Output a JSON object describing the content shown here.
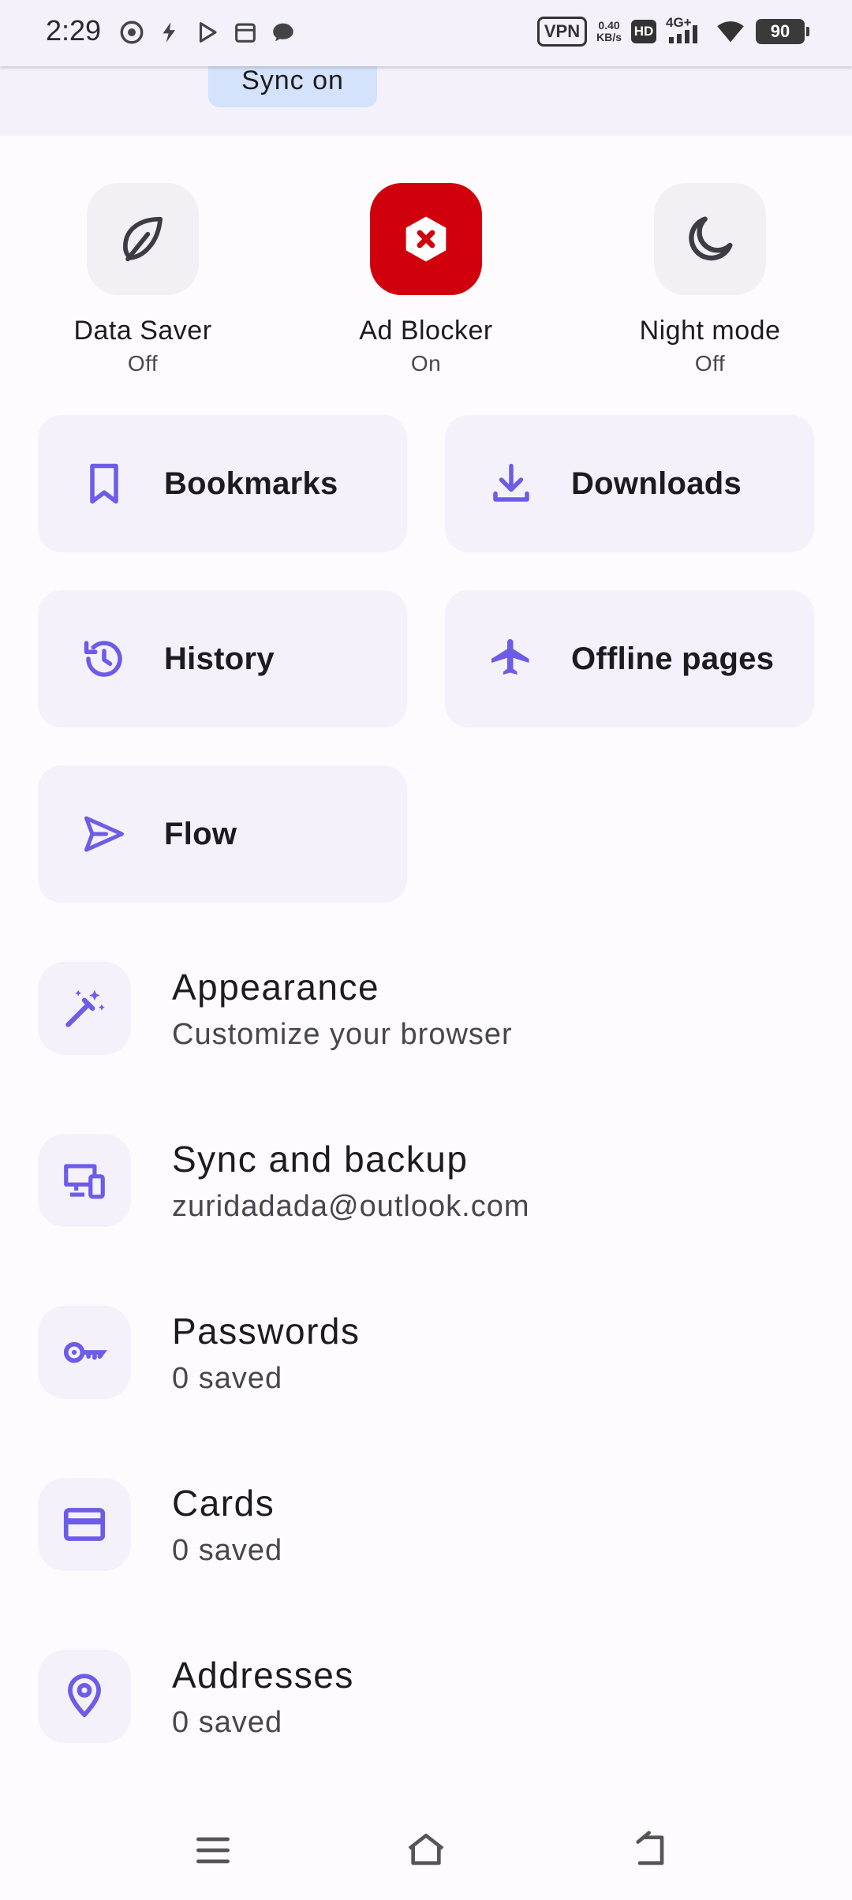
{
  "status_bar": {
    "time": "2:29",
    "vpn": "VPN",
    "net_speed_value": "0.40",
    "net_speed_unit": "KB/s",
    "hd": "HD",
    "signal": "4G+",
    "battery": "90"
  },
  "header": {
    "sync_label": "Sync on"
  },
  "quick_toggles": [
    {
      "label": "Data Saver",
      "state": "Off",
      "icon": "leaf-icon"
    },
    {
      "label": "Ad Blocker",
      "state": "On",
      "icon": "ad-blocker-icon"
    },
    {
      "label": "Night mode",
      "state": "Off",
      "icon": "moon-icon"
    }
  ],
  "tiles": [
    {
      "label": "Bookmarks",
      "icon": "bookmark-icon"
    },
    {
      "label": "Downloads",
      "icon": "download-icon"
    },
    {
      "label": "History",
      "icon": "history-icon"
    },
    {
      "label": "Offline pages",
      "icon": "airplane-icon"
    },
    {
      "label": "Flow",
      "icon": "send-icon"
    }
  ],
  "list": [
    {
      "title": "Appearance",
      "subtitle": "Customize your browser",
      "icon": "magic-wand-icon"
    },
    {
      "title": "Sync and backup",
      "subtitle": "zuridadada@outlook.com",
      "icon": "devices-icon"
    },
    {
      "title": "Passwords",
      "subtitle": "0 saved",
      "icon": "key-icon"
    },
    {
      "title": "Cards",
      "subtitle": "0 saved",
      "icon": "credit-card-icon"
    },
    {
      "title": "Addresses",
      "subtitle": "0 saved",
      "icon": "location-pin-icon"
    }
  ],
  "colors": {
    "accent": "#6c5ce7",
    "ad_blocker_active": "#d0000c",
    "sync_chip": "#d4e2fb",
    "tile_bg": "#f4f1fb"
  }
}
